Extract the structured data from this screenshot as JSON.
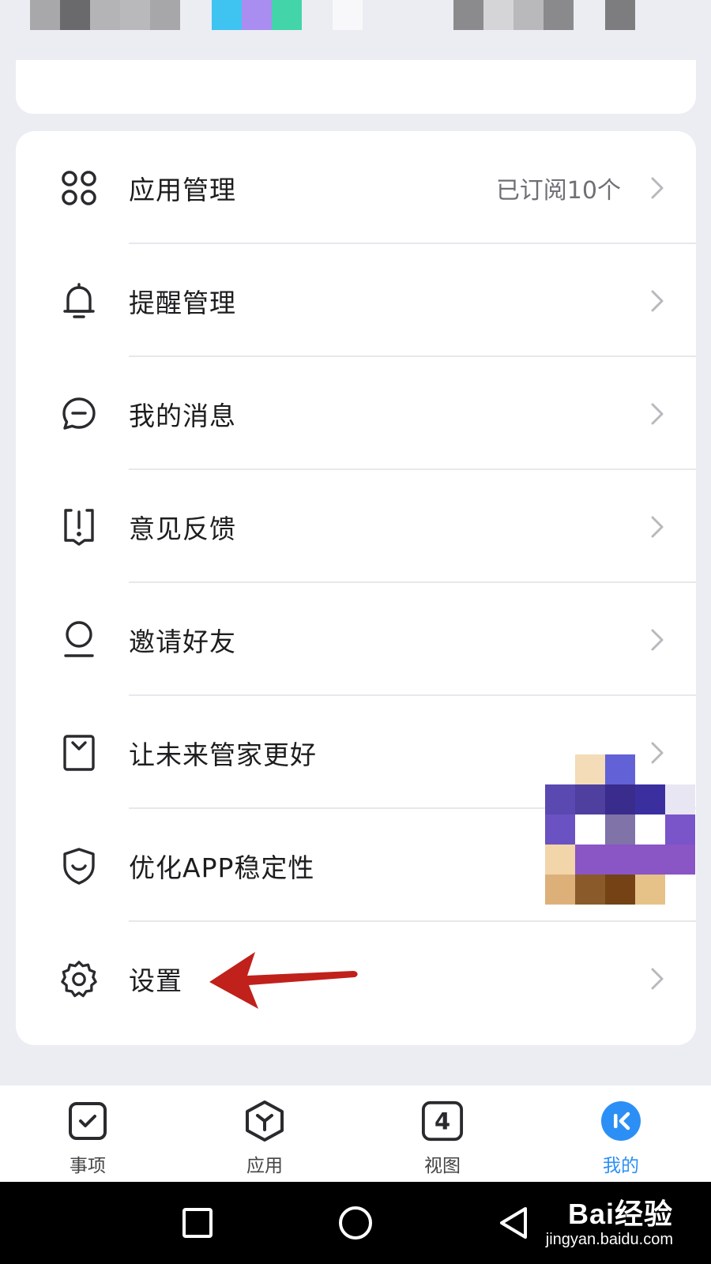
{
  "menu": {
    "items": [
      {
        "key": "app-management",
        "label": "应用管理",
        "value": "已订阅10个",
        "icon": "apps-grid-icon"
      },
      {
        "key": "reminder-management",
        "label": "提醒管理",
        "value": "",
        "icon": "bell-icon"
      },
      {
        "key": "my-messages",
        "label": "我的消息",
        "value": "",
        "icon": "chat-bubble-icon"
      },
      {
        "key": "feedback",
        "label": "意见反馈",
        "value": "",
        "icon": "feedback-icon"
      },
      {
        "key": "invite-friends",
        "label": "邀请好友",
        "value": "",
        "icon": "person-icon"
      },
      {
        "key": "make-better",
        "label": "让未来管家更好",
        "value": "",
        "icon": "mail-bag-icon"
      },
      {
        "key": "optimize-stability",
        "label": "优化APP稳定性",
        "value": "",
        "icon": "shield-smile-icon"
      },
      {
        "key": "settings",
        "label": "设置",
        "value": "",
        "icon": "gear-icon"
      }
    ]
  },
  "bottom_nav": {
    "items": [
      {
        "key": "tasks",
        "label": "事项",
        "icon": "checkbox-icon",
        "active": false
      },
      {
        "key": "apps",
        "label": "应用",
        "icon": "hexagon-y-icon",
        "active": false
      },
      {
        "key": "view",
        "label": "视图",
        "icon": "number-four-icon",
        "glyph": "4",
        "active": false
      },
      {
        "key": "mine",
        "label": "我的",
        "icon": "profile-circle-icon",
        "active": true
      }
    ]
  },
  "system_bar": {
    "buttons": [
      "recent-apps-icon",
      "home-icon",
      "back-icon"
    ]
  },
  "watermark": {
    "logo": "Bai经验",
    "url": "jingyan.baidu.com"
  },
  "colors": {
    "background": "#ebedf3",
    "card": "#ffffff",
    "accent": "#2c8ff5",
    "arrow": "#c0211b",
    "text": "#1d1d1f",
    "secondary_text": "#6f7075"
  }
}
